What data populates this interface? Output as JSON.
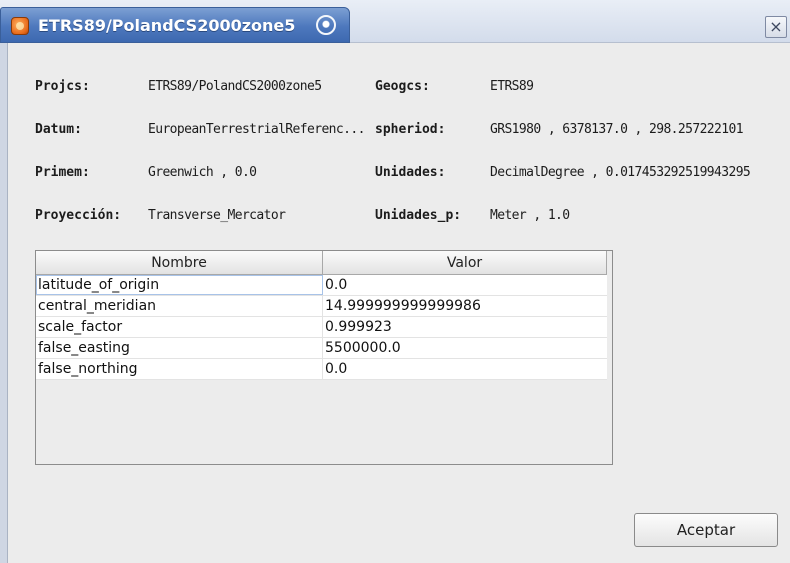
{
  "window": {
    "title": "ETRS89/PolandCS2000zone5",
    "close_glyph": "×"
  },
  "fields": {
    "projcs": {
      "label": "Projcs:",
      "value": "ETRS89/PolandCS2000zone5"
    },
    "geogcs": {
      "label": "Geogcs:",
      "value": "ETRS89"
    },
    "datum": {
      "label": "Datum:",
      "value": "EuropeanTerrestrialReferenc..."
    },
    "spheriod": {
      "label": "spheriod:",
      "value": "GRS1980 , 6378137.0 , 298.257222101"
    },
    "primem": {
      "label": "Primem:",
      "value": "Greenwich , 0.0"
    },
    "unidades": {
      "label": "Unidades:",
      "value": "DecimalDegree , 0.017453292519943295"
    },
    "proyeccion": {
      "label": "Proyección:",
      "value": "Transverse_Mercator"
    },
    "unidades_p": {
      "label": "Unidades_p:",
      "value": "Meter , 1.0"
    }
  },
  "table": {
    "columns": [
      "Nombre",
      "Valor"
    ],
    "rows": [
      {
        "name": "latitude_of_origin",
        "value": "0.0"
      },
      {
        "name": "central_meridian",
        "value": "14.999999999999986"
      },
      {
        "name": "scale_factor",
        "value": "0.999923"
      },
      {
        "name": "false_easting",
        "value": "5500000.0"
      },
      {
        "name": "false_northing",
        "value": "0.0"
      }
    ]
  },
  "buttons": {
    "accept": "Aceptar"
  },
  "colors": {
    "title_bar": "#4d78bd",
    "dialog_bg": "#ececec"
  },
  "icons": {
    "app": "gvsig-app-icon",
    "pin": "pin-icon",
    "close": "close-icon"
  }
}
